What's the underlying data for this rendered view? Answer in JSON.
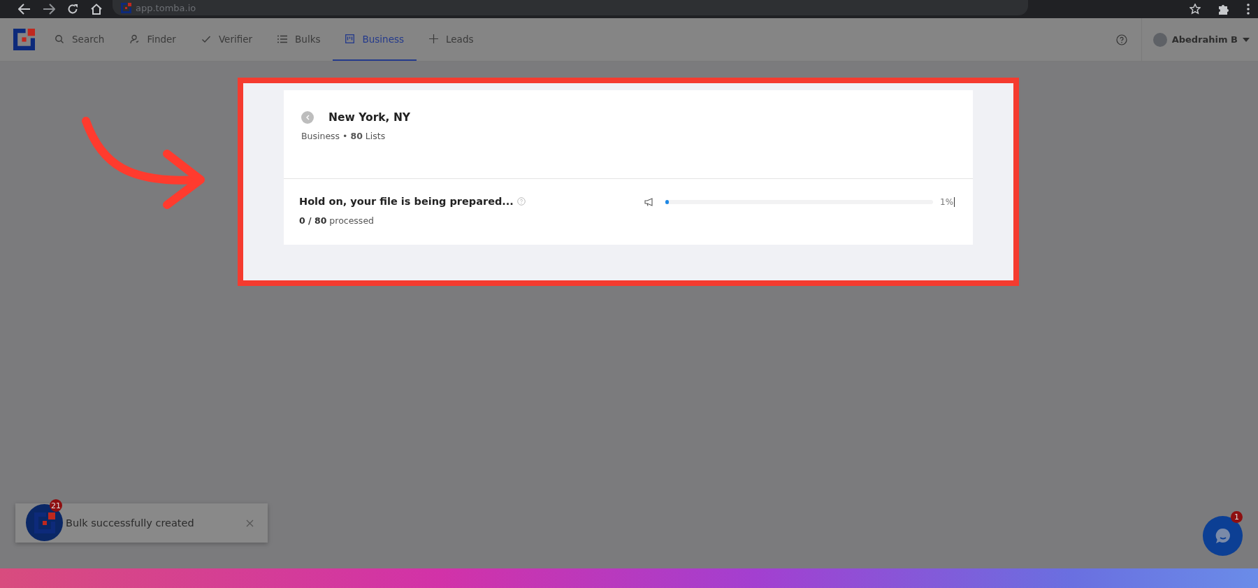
{
  "browser": {
    "url": "app.tomba.io"
  },
  "nav": {
    "tabs": [
      {
        "label": "Search",
        "kind": "search",
        "selected": false
      },
      {
        "label": "Finder",
        "kind": "person",
        "selected": false
      },
      {
        "label": "Verifier",
        "kind": "check",
        "selected": false
      },
      {
        "label": "Bulks",
        "kind": "list",
        "selected": false
      },
      {
        "label": "Business",
        "kind": "board",
        "selected": true
      },
      {
        "label": "Leads",
        "kind": "plus",
        "selected": false
      }
    ],
    "user": {
      "name": "Abedrahim B"
    }
  },
  "panel": {
    "title": "New York, NY",
    "subtitle": "Business • **80** Lists"
  },
  "progress": {
    "title": "Hold on, your file is being prepared...",
    "count": "**0 / 80** processed",
    "level": 0.01,
    "reading": "1%"
  },
  "toast": {
    "message": "Bulk successfully created",
    "badge": "21"
  },
  "chat": {
    "badge": "1"
  }
}
